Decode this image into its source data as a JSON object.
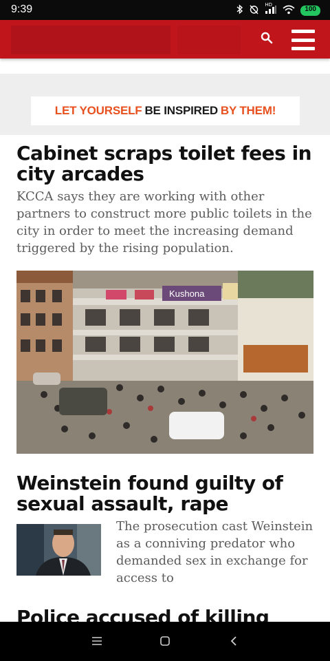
{
  "status_bar": {
    "time": "9:39",
    "signal_label": "HD",
    "battery": "100"
  },
  "header": {
    "icons": [
      "search-icon",
      "hamburger-menu-icon"
    ],
    "color": "#c0151b"
  },
  "banner": {
    "part1": "LET YOURSELF",
    "part2": "BE INSPIRED",
    "part3": "BY THEM!"
  },
  "articles": [
    {
      "title": "Cabinet scraps toilet fees in city arcades",
      "summary": "KCCA says they are working with other partners to construct more public toilets in the city in order to meet the increasing demand triggered by the rising population.",
      "image_sign": "Kushona"
    },
    {
      "title": "Weinstein found guilty of sexual assault, rape",
      "summary": "The prosecution cast Weinstein as a conniving predator who demanded sex in exchange for access to"
    },
    {
      "title": "Police accused of killing People"
    }
  ],
  "nav_bar": {
    "icons": [
      "recents-icon",
      "home-icon",
      "back-icon"
    ]
  }
}
